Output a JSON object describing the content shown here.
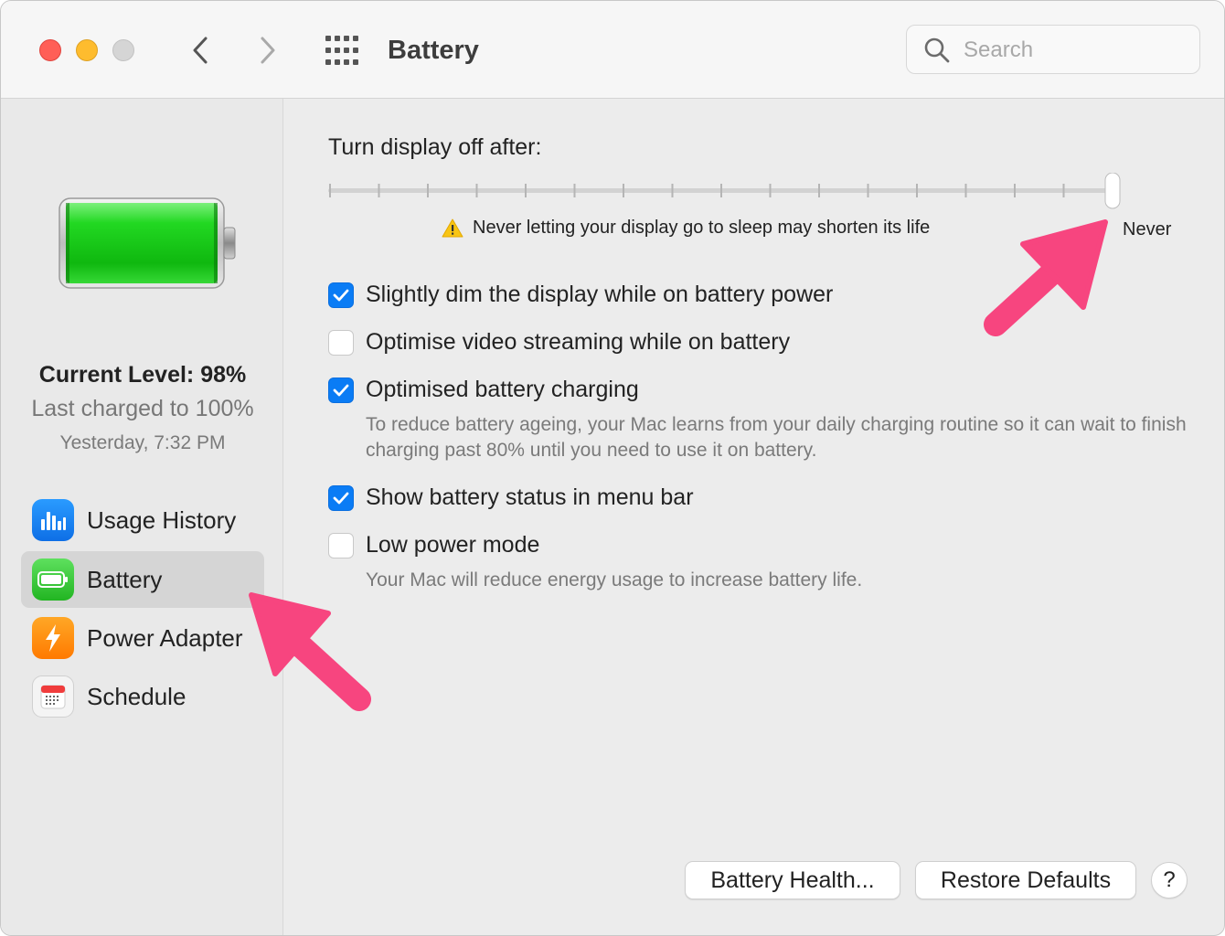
{
  "window": {
    "title": "Battery",
    "search_placeholder": "Search"
  },
  "sidebar": {
    "current_level": "Current Level: 98%",
    "last_charged": "Last charged to 100%",
    "charged_time": "Yesterday, 7:32 PM",
    "battery_level_fraction": 0.98,
    "items": [
      {
        "label": "Usage History",
        "icon": "usage-history-icon",
        "selected": false
      },
      {
        "label": "Battery",
        "icon": "battery-icon",
        "selected": true
      },
      {
        "label": "Power Adapter",
        "icon": "power-adapter-icon",
        "selected": false
      },
      {
        "label": "Schedule",
        "icon": "schedule-icon",
        "selected": false
      }
    ]
  },
  "display_sleep": {
    "label": "Turn display off after:",
    "value_label": "Never",
    "slider_position": 1.0,
    "warning": "Never letting your display go to sleep may shorten its life"
  },
  "options": [
    {
      "label": "Slightly dim the display while on battery power",
      "checked": true
    },
    {
      "label": "Optimise video streaming while on battery",
      "checked": false
    },
    {
      "label": "Optimised battery charging",
      "checked": true,
      "help": "To reduce battery ageing, your Mac learns from your daily charging routine so it can wait to finish charging past 80% until you need to use it on battery."
    },
    {
      "label": "Show battery status in menu bar",
      "checked": true
    },
    {
      "label": "Low power mode",
      "checked": false,
      "help": "Your Mac will reduce energy usage to increase battery life."
    }
  ],
  "buttons": {
    "battery_health": "Battery Health...",
    "restore_defaults": "Restore Defaults",
    "help": "?"
  },
  "colors": {
    "accent": "#0a7cf5",
    "annotation_arrow": "#f7457f",
    "battery_green": "#20d020"
  }
}
